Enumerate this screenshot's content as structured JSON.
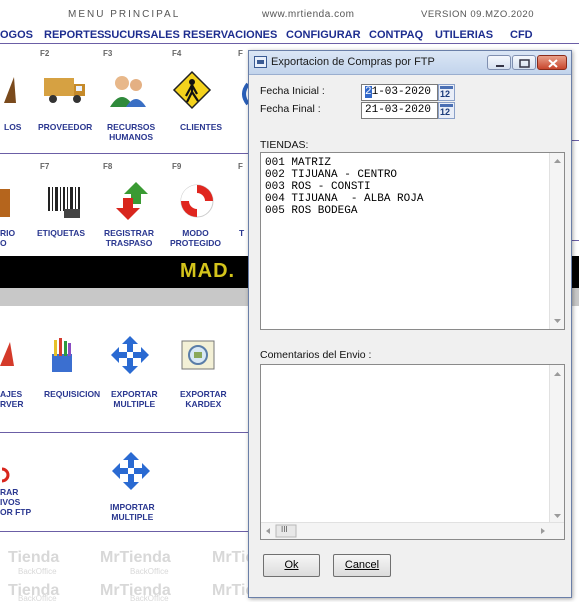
{
  "header": {
    "title": "MENU PRINCIPAL",
    "site": "www.mrtienda.com",
    "version": "VERSION  09.MZO.2020"
  },
  "menu": [
    "OGOS",
    "REPORTES",
    "SUCURSALES",
    "RESERVACIONES",
    "CONFIGURAR",
    "CONTPAQ",
    "UTILERIAS",
    "CFD"
  ],
  "row1": {
    "fkeys": [
      "F2",
      "F3",
      "F4",
      "F"
    ],
    "tiles": [
      "LOS",
      "PROVEEDOR",
      "RECURSOS\nHUMANOS",
      "CLIENTES"
    ]
  },
  "row2": {
    "fkeys": [
      "F7",
      "F8",
      "F9",
      "F"
    ],
    "tiles": [
      "RIO\nO",
      "ETIQUETAS",
      "REGISTRAR\nTRASPASO",
      "MODO\nPROTEGIDO",
      "T"
    ]
  },
  "banner": "MAD.",
  "row3": {
    "tiles": [
      "AJES\nRVER",
      "REQUISICION",
      "EXPORTAR\nMULTIPLE",
      "EXPORTAR\nKARDEX"
    ]
  },
  "row4": {
    "tiles": [
      "RAR\nIVOS\nOR FTP",
      "IMPORTAR\nMULTIPLE"
    ]
  },
  "watermark": {
    "brand": "MrTienda",
    "partial": "Tienda",
    "sub": "BackOffice"
  },
  "dialog": {
    "title": "Exportacion de Compras por FTP",
    "fecha_inicial_label": "Fecha Inicial :",
    "fecha_inicial_value_first": "2",
    "fecha_inicial_value_rest": "1-03-2020",
    "fecha_final_label": "Fecha Final  :",
    "fecha_final_value": "21-03-2020",
    "cal_label": "12",
    "tiendas_label": "TIENDAS:",
    "tiendas": [
      "001 MATRIZ",
      "002 TIJUANA - CENTRO",
      "003 ROS - CONSTI",
      "004 TIJUANA  - ALBA ROJA",
      "005 ROS BODEGA"
    ],
    "comentarios_label": "Comentarios del Envio :",
    "scroll_thumb": "III",
    "ok_label": "Ok",
    "cancel_label": "Cancel"
  }
}
